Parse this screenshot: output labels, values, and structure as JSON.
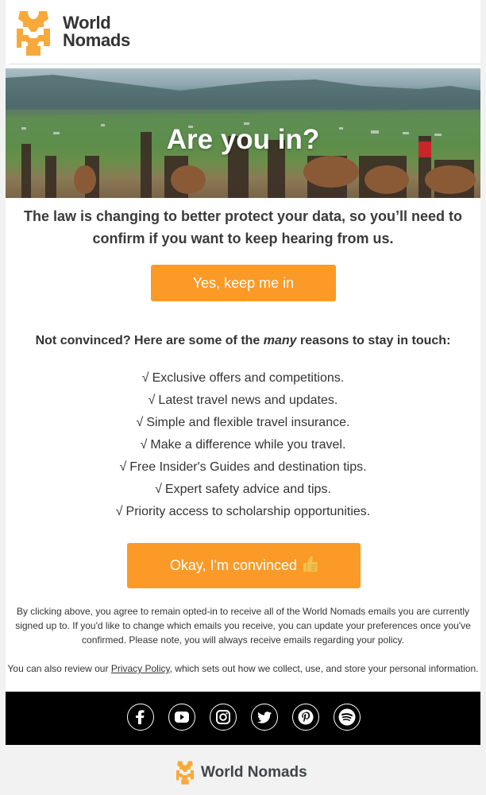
{
  "header": {
    "brand_line1": "World",
    "brand_line2": "Nomads",
    "brand_color": "#f9a93a"
  },
  "hero": {
    "title": "Are you in?"
  },
  "intro": {
    "text": "The law is changing to better protect your data, so you’ll need to confirm if you want to keep hearing from us."
  },
  "primary_button": {
    "label": "Yes, keep me in",
    "color": "#fb9a26"
  },
  "reasons": {
    "heading_before": "Not convinced? Here are some of the ",
    "heading_emphasis": "many",
    "heading_after": " reasons to stay in touch:",
    "check_glyph": "√",
    "items": [
      "Exclusive offers and competitions.",
      "Latest travel news and updates.",
      "Simple and flexible travel insurance.",
      "Make a difference while you travel.",
      "Free Insider's Guides and destination tips.",
      "Expert safety advice and tips.",
      "Priority access to scholarship opportunities."
    ]
  },
  "secondary_button": {
    "label": "Okay, I'm convinced",
    "icon": "thumbs-up-icon"
  },
  "fine_print": {
    "text": "By clicking above, you agree to remain opted-in to receive all of the World Nomads emails you are currently signed up to. If you'd like to change which emails you receive, you can update your preferences once you've confirmed. Please note, you will always receive emails regarding your policy."
  },
  "privacy": {
    "before": "You can also review our ",
    "link": "Privacy Policy",
    "after": ", which sets out how we collect, use, and store your personal information."
  },
  "social": {
    "icons": [
      "facebook-icon",
      "youtube-icon",
      "instagram-icon",
      "twitter-icon",
      "pinterest-icon",
      "spotify-icon"
    ]
  },
  "footer": {
    "brand": "World Nomads"
  }
}
